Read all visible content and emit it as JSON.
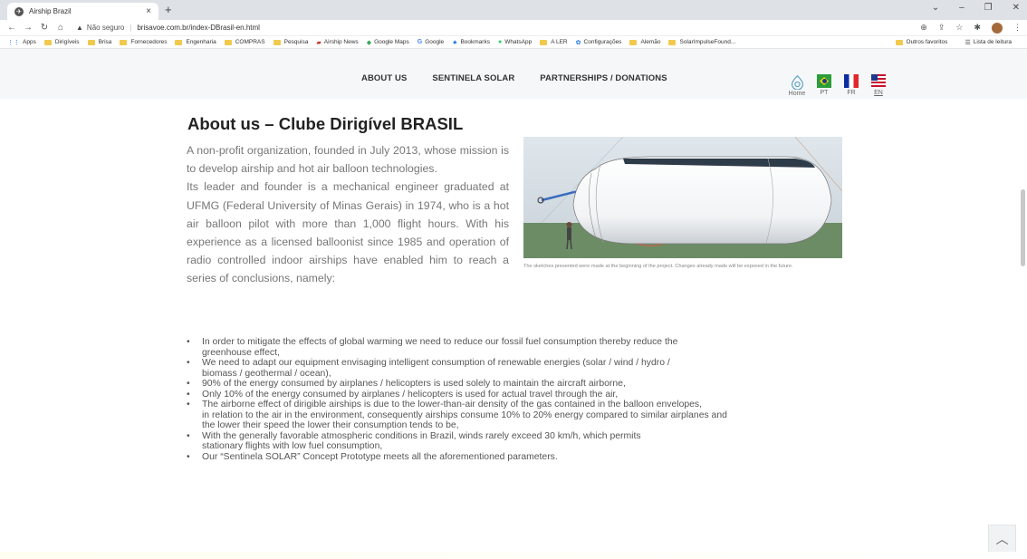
{
  "browser": {
    "tab_title": "Airship Brazil",
    "tab_close": "×",
    "new_tab": "+",
    "security_label": "Não seguro",
    "url": "brisavoe.com.br/index-DBrasil-en.html",
    "window_controls": [
      "⌄",
      "–",
      "❐",
      "✕"
    ],
    "bookmarks": [
      {
        "label": "Apps",
        "icon": "apps-grid-icon"
      },
      {
        "label": "Dirigíveis",
        "icon": "folder-icon"
      },
      {
        "label": "Brisa",
        "icon": "folder-icon"
      },
      {
        "label": "Fornecedores",
        "icon": "folder-icon"
      },
      {
        "label": "Engenharia",
        "icon": "folder-icon"
      },
      {
        "label": "COMPRAS",
        "icon": "folder-icon"
      },
      {
        "label": "Pesquisa",
        "icon": "folder-icon"
      },
      {
        "label": "Airship News",
        "icon": "news-icon"
      },
      {
        "label": "Google Maps",
        "icon": "maps-icon"
      },
      {
        "label": "Google",
        "icon": "google-icon"
      },
      {
        "label": "Bookmarks",
        "icon": "star-icon"
      },
      {
        "label": "WhatsApp",
        "icon": "whatsapp-icon"
      },
      {
        "label": "A LER",
        "icon": "folder-icon"
      },
      {
        "label": "Configurações",
        "icon": "gear-icon"
      },
      {
        "label": "Alemão",
        "icon": "folder-icon"
      },
      {
        "label": "SolarImpulseFound...",
        "icon": "folder-icon"
      }
    ],
    "bookmarks_right": [
      {
        "label": "Outros favoritos"
      },
      {
        "label": "Lista de leitura"
      }
    ]
  },
  "site": {
    "nav": [
      "ABOUT US",
      "SENTINELA SOLAR",
      "PARTNERSHIPS / DONATIONS"
    ],
    "langs": [
      {
        "label": "Home",
        "icon": "home-icon"
      },
      {
        "label": "PT",
        "icon": "brazil-flag-icon"
      },
      {
        "label": "FR",
        "icon": "france-flag-icon"
      },
      {
        "label": "EN",
        "icon": "usa-flag-icon"
      }
    ],
    "title": "About us – Clube Dirigível BRASIL",
    "intro": [
      "A non-profit organization, founded in July 2013, whose mission is to develop airship and hot air balloon technologies.",
      "Its leader and founder is a mechanical engineer graduated at UFMG (Federal University of Minas Gerais) in 1974, who is a hot air balloon pilot with more than 1,000 flight hours. With his experience as a licensed balloonist since 1985 and operation of radio controlled indoor airships have enabled him to reach a series of conclusions, namely:"
    ],
    "caption": "The sketches presented were made at the beginning of the project. Changes already made will be exposed in the future.",
    "bullets": [
      "In order to mitigate the effects of global warming we need to reduce our fossil fuel consumption thereby reduce the\n greenhouse effect,",
      "We need to adapt our equipment envisaging intelligent consumption of renewable energies (solar / wind / hydro /\n  biomass / geothermal / ocean),",
      "90% of the energy consumed by airplanes / helicopters is used solely to maintain the aircraft airborne,",
      "Only 10% of the energy consumed by airplanes / helicopters is used for actual travel through the air,",
      "The airborne effect of dirigible airships is due to the lower-than-air density of the gas contained in the balloon envelopes,\n in relation to the air in the environment, consequently airships consume 10% to 20% energy compared to similar airplanes and\n the lower their speed the lower their consumption tends to be,",
      "With the generally favorable atmospheric conditions in Brazil, winds rarely exceed 30 km/h, which permits\n stationary flights with low fuel consumption,",
      "Our “Sentinela SOLAR” Concept Prototype meets all the aforementioned parameters."
    ],
    "scroll_top": "︿"
  }
}
